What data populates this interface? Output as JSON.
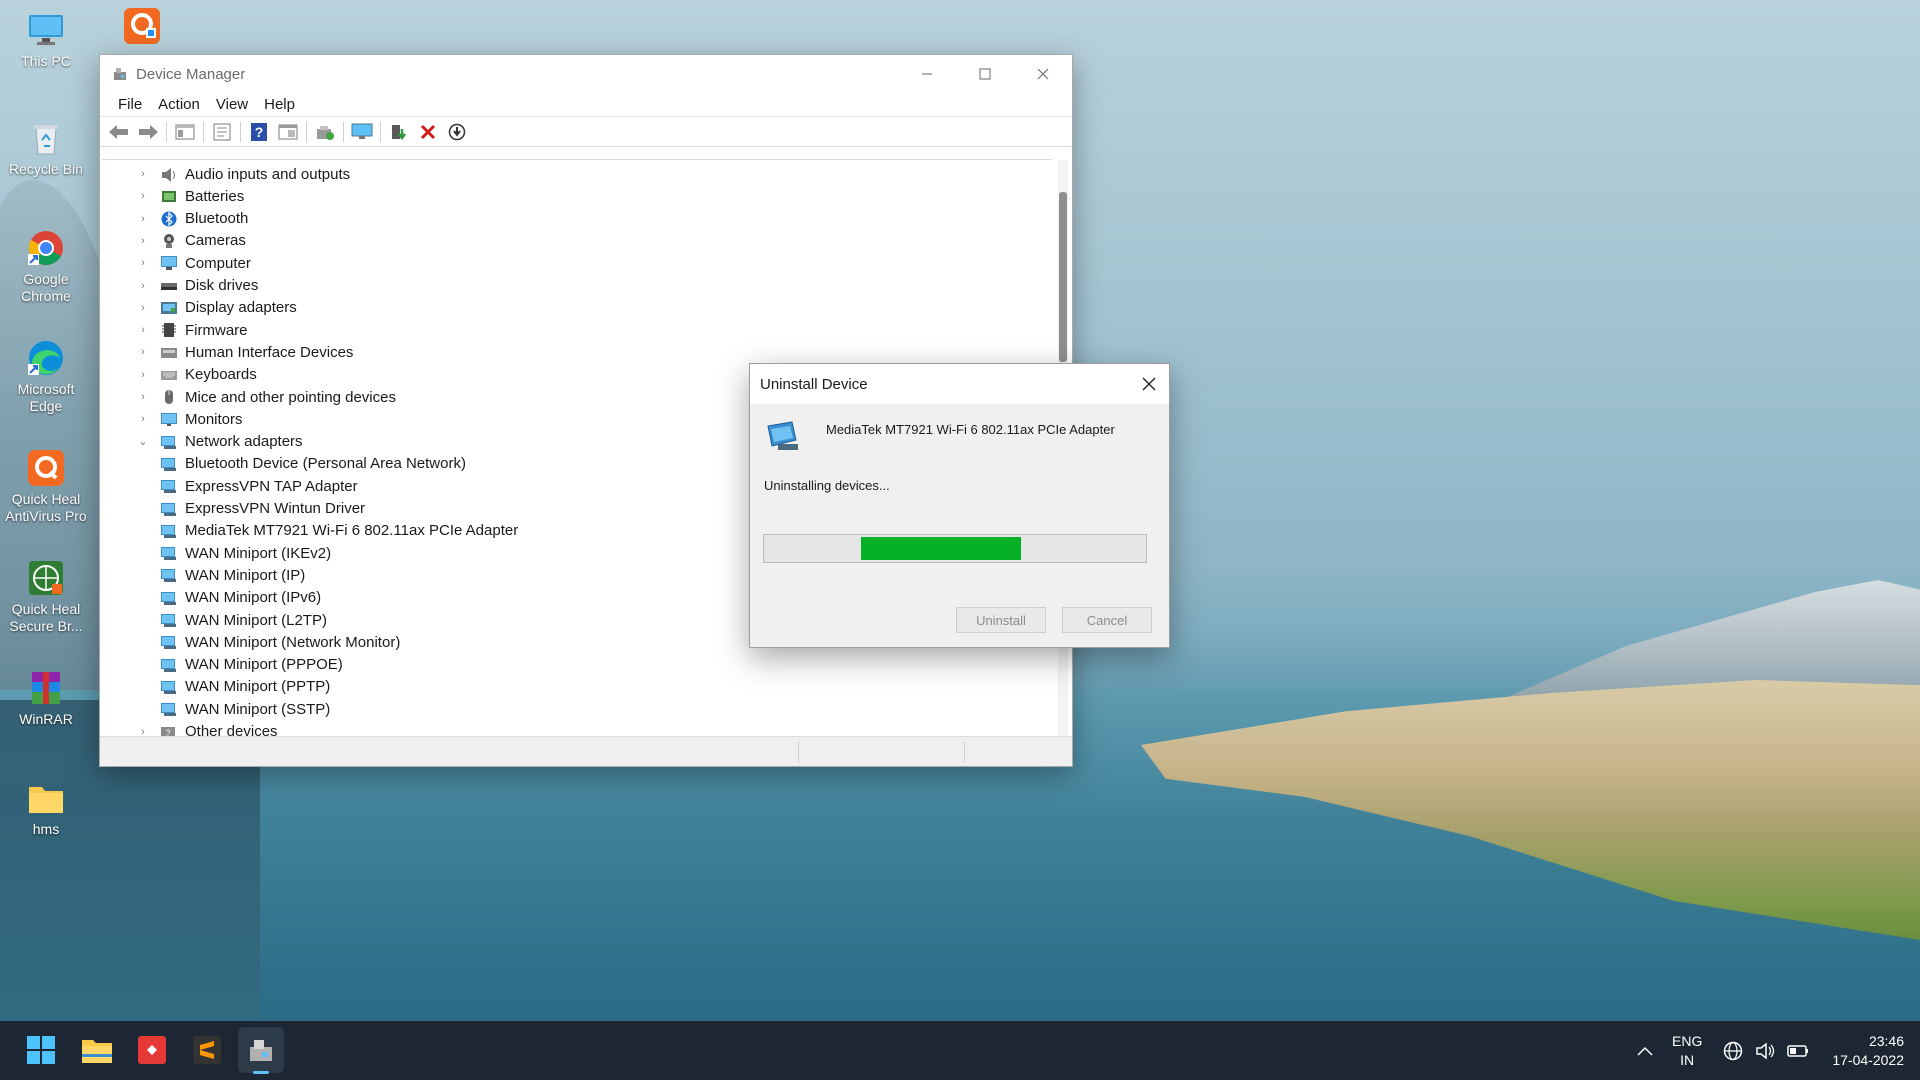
{
  "desktop": {
    "icons": [
      {
        "label": "This PC",
        "icon": "monitor-icon"
      },
      {
        "label": "Recycle Bin",
        "icon": "recycle-bin-icon"
      },
      {
        "label": "Google Chrome",
        "icon": "chrome-icon"
      },
      {
        "label": "Microsoft Edge",
        "icon": "edge-icon"
      },
      {
        "label": "Quick Heal AntiVirus Pro",
        "icon": "quickheal-icon"
      },
      {
        "label": "Quick Heal Secure Br...",
        "icon": "quickheal-browser-icon"
      },
      {
        "label": "WinRAR",
        "icon": "winrar-icon"
      },
      {
        "label": "hms",
        "icon": "folder-icon"
      }
    ],
    "top_icon": "quickheal-shortcut-icon"
  },
  "device_manager": {
    "title": "Device Manager",
    "menu": [
      "File",
      "Action",
      "View",
      "Help"
    ],
    "toolbar_icons": [
      "back-icon",
      "forward-icon",
      "show-hide-tree-icon",
      "properties-icon",
      "help-icon",
      "view-icon",
      "scan-hardware-icon",
      "monitor-device-icon",
      "update-driver-icon",
      "uninstall-icon",
      "disable-device-icon"
    ],
    "tree": [
      {
        "label": "Audio inputs and outputs",
        "level": 0,
        "expanded": false,
        "icon": "audio-icon"
      },
      {
        "label": "Batteries",
        "level": 0,
        "expanded": false,
        "icon": "battery-icon"
      },
      {
        "label": "Bluetooth",
        "level": 0,
        "expanded": false,
        "icon": "bluetooth-icon"
      },
      {
        "label": "Cameras",
        "level": 0,
        "expanded": false,
        "icon": "camera-icon"
      },
      {
        "label": "Computer",
        "level": 0,
        "expanded": false,
        "icon": "computer-icon"
      },
      {
        "label": "Disk drives",
        "level": 0,
        "expanded": false,
        "icon": "disk-icon"
      },
      {
        "label": "Display adapters",
        "level": 0,
        "expanded": false,
        "icon": "display-adapter-icon"
      },
      {
        "label": "Firmware",
        "level": 0,
        "expanded": false,
        "icon": "firmware-icon"
      },
      {
        "label": "Human Interface Devices",
        "level": 0,
        "expanded": false,
        "icon": "hid-icon"
      },
      {
        "label": "Keyboards",
        "level": 0,
        "expanded": false,
        "icon": "keyboard-icon"
      },
      {
        "label": "Mice and other pointing devices",
        "level": 0,
        "expanded": false,
        "icon": "mouse-icon"
      },
      {
        "label": "Monitors",
        "level": 0,
        "expanded": false,
        "icon": "monitor-icon"
      },
      {
        "label": "Network adapters",
        "level": 0,
        "expanded": true,
        "icon": "network-adapter-icon"
      },
      {
        "label": "Bluetooth Device (Personal Area Network)",
        "level": 1,
        "icon": "network-adapter-icon"
      },
      {
        "label": "ExpressVPN TAP Adapter",
        "level": 1,
        "icon": "network-adapter-icon"
      },
      {
        "label": "ExpressVPN Wintun Driver",
        "level": 1,
        "icon": "network-adapter-icon"
      },
      {
        "label": "MediaTek MT7921 Wi-Fi 6 802.11ax PCIe Adapter",
        "level": 1,
        "icon": "network-adapter-icon"
      },
      {
        "label": "WAN Miniport (IKEv2)",
        "level": 1,
        "icon": "network-adapter-icon"
      },
      {
        "label": "WAN Miniport (IP)",
        "level": 1,
        "icon": "network-adapter-icon"
      },
      {
        "label": "WAN Miniport (IPv6)",
        "level": 1,
        "icon": "network-adapter-icon"
      },
      {
        "label": "WAN Miniport (L2TP)",
        "level": 1,
        "icon": "network-adapter-icon"
      },
      {
        "label": "WAN Miniport (Network Monitor)",
        "level": 1,
        "icon": "network-adapter-icon"
      },
      {
        "label": "WAN Miniport (PPPOE)",
        "level": 1,
        "icon": "network-adapter-icon"
      },
      {
        "label": "WAN Miniport (PPTP)",
        "level": 1,
        "icon": "network-adapter-icon"
      },
      {
        "label": "WAN Miniport (SSTP)",
        "level": 1,
        "icon": "network-adapter-icon"
      },
      {
        "label": "Other devices",
        "level": 0,
        "expanded": false,
        "icon": "other-devices-icon"
      }
    ]
  },
  "dialog": {
    "title": "Uninstall Device",
    "device_name": "MediaTek MT7921 Wi-Fi 6 802.11ax PCIe Adapter",
    "status": "Uninstalling devices...",
    "progress_start": 0.25,
    "progress_end": 0.67,
    "uninstall_label": "Uninstall",
    "cancel_label": "Cancel",
    "progress_color": "#06b025"
  },
  "taskbar": {
    "apps": [
      "start-icon",
      "file-explorer-icon",
      "git-icon",
      "sublime-text-icon",
      "device-manager-icon"
    ],
    "language": "ENG",
    "region": "IN",
    "time": "23:46",
    "date": "17-04-2022"
  }
}
